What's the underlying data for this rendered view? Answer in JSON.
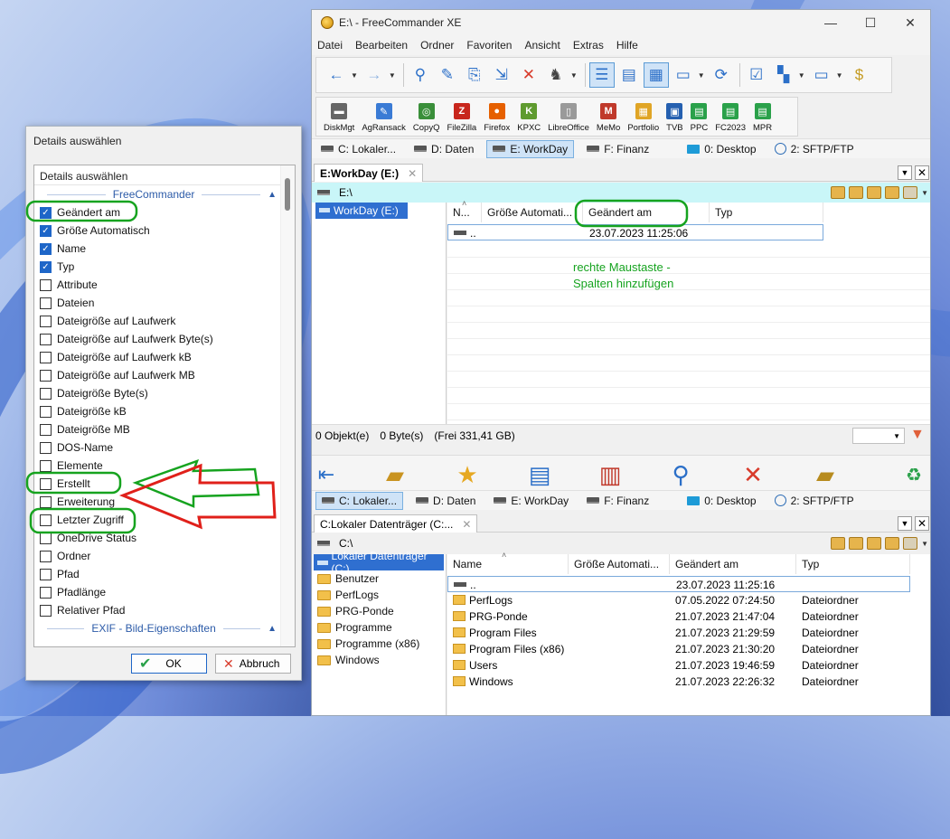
{
  "window": {
    "title": "E:\\ - FreeCommander XE",
    "min_label": "—",
    "max_label": "☐",
    "close_label": "✕"
  },
  "menu": [
    "Datei",
    "Bearbeiten",
    "Ordner",
    "Favoriten",
    "Ansicht",
    "Extras",
    "Hilfe"
  ],
  "tools": [
    {
      "label": "DiskMgt",
      "color": "#666666",
      "glyph": "▬"
    },
    {
      "label": "AgRansack",
      "color": "#3a7bd5",
      "glyph": "✎"
    },
    {
      "label": "CopyQ",
      "color": "#3a8f3a",
      "glyph": "◎"
    },
    {
      "label": "FileZilla",
      "color": "#c8261c",
      "glyph": "Z"
    },
    {
      "label": "Firefox",
      "color": "#e66000",
      "glyph": "●"
    },
    {
      "label": "KPXC",
      "color": "#5f9b2f",
      "glyph": "K"
    },
    {
      "label": "LibreOffice",
      "color": "#9a9a9a",
      "glyph": "▯"
    },
    {
      "label": "MeMo",
      "color": "#c0392b",
      "glyph": "M"
    },
    {
      "label": "Portfolio",
      "color": "#e0a526",
      "glyph": "▦"
    },
    {
      "label": "TVB",
      "color": "#2560b0",
      "glyph": "▣"
    },
    {
      "label": "PPC",
      "color": "#2aa14a",
      "glyph": "▤"
    },
    {
      "label": "FC2023",
      "color": "#2aa14a",
      "glyph": "▤"
    },
    {
      "label": "MPR",
      "color": "#2aa14a",
      "glyph": "▤"
    }
  ],
  "drives_top": [
    {
      "label": "C: Lokaler...",
      "icon": "drive-icon"
    },
    {
      "label": "D: Daten",
      "icon": "drive-icon"
    },
    {
      "label": "E: WorkDay",
      "icon": "drive-icon",
      "active": true
    },
    {
      "label": "F: Finanz",
      "icon": "drive-icon"
    },
    {
      "label": "0: Desktop",
      "icon": "desktop-icon"
    },
    {
      "label": "2: SFTP/FTP",
      "icon": "globe-icon"
    }
  ],
  "drives_bottom": [
    {
      "label": "C: Lokaler...",
      "icon": "drive-icon",
      "active": true
    },
    {
      "label": "D: Daten",
      "icon": "drive-icon"
    },
    {
      "label": "E: WorkDay",
      "icon": "drive-icon"
    },
    {
      "label": "F: Finanz",
      "icon": "drive-icon"
    },
    {
      "label": "0: Desktop",
      "icon": "desktop-icon"
    },
    {
      "label": "2: SFTP/FTP",
      "icon": "globe-icon"
    }
  ],
  "top_panel": {
    "tab": "E:WorkDay (E:)",
    "path": "E:\\",
    "tree": [
      "WorkDay (E:)"
    ],
    "columns": [
      "N...",
      "Größe Automati...",
      "Geändert am",
      "Typ"
    ],
    "rows": [
      {
        "name": "..",
        "size": "",
        "date": "23.07.2023 11:25:06",
        "type": ""
      }
    ],
    "status": [
      "0 Objekt(e)",
      "0 Byte(s)",
      "(Frei 331,41 GB)"
    ]
  },
  "bottom_panel": {
    "tab": "C:Lokaler Datenträger (C:...",
    "path": "C:\\",
    "tree": [
      "Lokaler Datenträger (C:)",
      "Benutzer",
      "PerfLogs",
      "PRG-Ponde",
      "Programme",
      "Programme (x86)",
      "Windows"
    ],
    "columns": [
      "Name",
      "Größe Automati...",
      "Geändert am",
      "Typ"
    ],
    "rows": [
      {
        "name": "..",
        "size": "",
        "date": "23.07.2023 11:25:16",
        "type": ""
      },
      {
        "name": "PerfLogs",
        "size": "",
        "date": "07.05.2022 07:24:50",
        "type": "Dateiordner"
      },
      {
        "name": "PRG-Ponde",
        "size": "",
        "date": "21.07.2023 21:47:04",
        "type": "Dateiordner"
      },
      {
        "name": "Program Files",
        "size": "",
        "date": "21.07.2023 21:29:59",
        "type": "Dateiordner"
      },
      {
        "name": "Program Files (x86)",
        "size": "",
        "date": "21.07.2023 21:30:20",
        "type": "Dateiordner"
      },
      {
        "name": "Users",
        "size": "",
        "date": "21.07.2023 19:46:59",
        "type": "Dateiordner"
      },
      {
        "name": "Windows",
        "size": "",
        "date": "21.07.2023 22:26:32",
        "type": "Dateiordner"
      }
    ]
  },
  "annotation": {
    "line1": "rechte Maustaste -",
    "line2": "Spalten hinzufügen",
    "color": "#16a31f",
    "arrow_green": "#16a31f",
    "arrow_red": "#e0201a"
  },
  "dialog": {
    "title": "Details auswählen",
    "header": "Details auswählen",
    "group1": "FreeCommander",
    "group2": "EXIF - Bild-Eigenschaften",
    "items": [
      {
        "label": "Geändert am",
        "checked": true
      },
      {
        "label": "Größe Automatisch",
        "checked": true
      },
      {
        "label": "Name",
        "checked": true
      },
      {
        "label": "Typ",
        "checked": true
      },
      {
        "label": "Attribute",
        "checked": false
      },
      {
        "label": "Dateien",
        "checked": false
      },
      {
        "label": "Dateigröße auf Laufwerk",
        "checked": false
      },
      {
        "label": "Dateigröße auf Laufwerk Byte(s)",
        "checked": false
      },
      {
        "label": "Dateigröße auf Laufwerk kB",
        "checked": false
      },
      {
        "label": "Dateigröße auf Laufwerk MB",
        "checked": false
      },
      {
        "label": "Dateigröße Byte(s)",
        "checked": false
      },
      {
        "label": "Dateigröße kB",
        "checked": false
      },
      {
        "label": "Dateigröße MB",
        "checked": false
      },
      {
        "label": "DOS-Name",
        "checked": false
      },
      {
        "label": "Elemente",
        "checked": false
      },
      {
        "label": "Erstellt",
        "checked": false
      },
      {
        "label": "Erweiterung",
        "checked": false
      },
      {
        "label": "Letzter Zugriff",
        "checked": false
      },
      {
        "label": "OneDrive Status",
        "checked": false
      },
      {
        "label": "Ordner",
        "checked": false
      },
      {
        "label": "Pfad",
        "checked": false
      },
      {
        "label": "Pfadlänge",
        "checked": false
      },
      {
        "label": "Relativer Pfad",
        "checked": false
      }
    ],
    "ok": "OK",
    "cancel": "Abbruch"
  }
}
